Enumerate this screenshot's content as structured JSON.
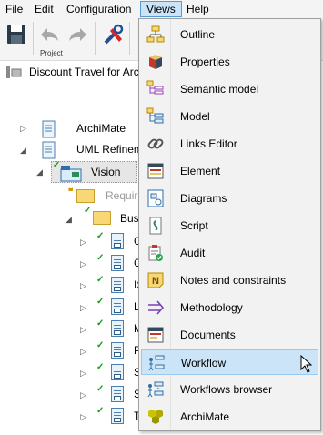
{
  "menubar": {
    "items": [
      {
        "label": "File"
      },
      {
        "label": "Edit"
      },
      {
        "label": "Configuration"
      },
      {
        "label": "Views"
      },
      {
        "label": "Help"
      }
    ]
  },
  "toolbar": {
    "group_label": "Project"
  },
  "tab": {
    "title": "Discount Travel for Archi"
  },
  "tree": {
    "items": [
      {
        "label": "ArchiMate"
      },
      {
        "label": "UML Refinem"
      },
      {
        "label": "Vision"
      },
      {
        "label": "Require"
      },
      {
        "label": "Busi"
      },
      {
        "label": "C"
      },
      {
        "label": "C"
      },
      {
        "label": "IS"
      },
      {
        "label": "L"
      },
      {
        "label": "M"
      },
      {
        "label": "P"
      },
      {
        "label": "S"
      },
      {
        "label": "S"
      },
      {
        "label": "T"
      }
    ]
  },
  "views_menu": {
    "items": [
      {
        "label": "Outline",
        "icon": "outline-icon"
      },
      {
        "label": "Properties",
        "icon": "properties-icon"
      },
      {
        "label": "Semantic model",
        "icon": "semantic-model-icon"
      },
      {
        "label": "Model",
        "icon": "model-icon"
      },
      {
        "label": "Links Editor",
        "icon": "links-icon"
      },
      {
        "label": "Element",
        "icon": "element-icon"
      },
      {
        "label": "Diagrams",
        "icon": "diagrams-icon"
      },
      {
        "label": "Script",
        "icon": "script-icon"
      },
      {
        "label": "Audit",
        "icon": "audit-icon"
      },
      {
        "label": "Notes and constraints",
        "icon": "notes-icon"
      },
      {
        "label": "Methodology",
        "icon": "methodology-icon"
      },
      {
        "label": "Documents",
        "icon": "documents-icon"
      },
      {
        "label": "Workflow",
        "icon": "workflow-icon"
      },
      {
        "label": "Workflows browser",
        "icon": "workflows-browser-icon"
      },
      {
        "label": "ArchiMate",
        "icon": "archimate-icon"
      }
    ],
    "highlighted": "Workflow"
  }
}
